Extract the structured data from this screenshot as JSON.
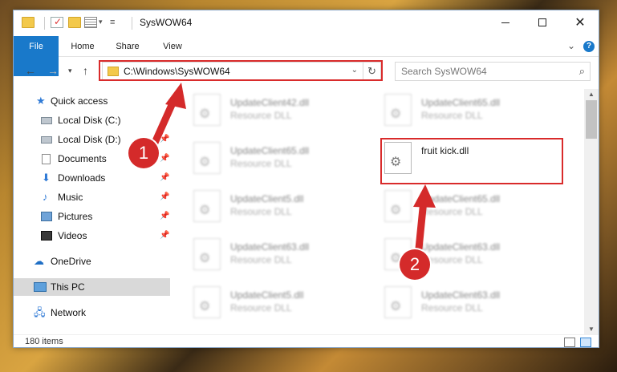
{
  "titlebar": {
    "title": "SysWOW64",
    "minimize_glyph": "",
    "close_glyph": "✕"
  },
  "ribbon": {
    "tabs": [
      "File",
      "Home",
      "Share",
      "View"
    ],
    "expand_glyph": "⌄",
    "help_glyph": "?"
  },
  "address": {
    "path": "C:\\Windows\\SysWOW64",
    "refresh_glyph": "↻"
  },
  "search": {
    "placeholder": "Search SysWOW64",
    "icon_glyph": "⌕"
  },
  "nav": {
    "items": [
      {
        "label": "Quick access",
        "icon": "star-icon"
      },
      {
        "label": "Local Disk (C:)",
        "icon": "drive-icon"
      },
      {
        "label": "Local Disk (D:)",
        "icon": "drive-icon"
      },
      {
        "label": "Documents",
        "icon": "documents-icon"
      },
      {
        "label": "Downloads",
        "icon": "download-icon"
      },
      {
        "label": "Music",
        "icon": "music-icon"
      },
      {
        "label": "Pictures",
        "icon": "pictures-icon"
      },
      {
        "label": "Videos",
        "icon": "videos-icon"
      },
      {
        "label": "OneDrive",
        "icon": "cloud-icon"
      },
      {
        "label": "This PC",
        "icon": "computer-icon"
      },
      {
        "label": "Network",
        "icon": "network-icon"
      }
    ]
  },
  "files": [
    {
      "name": "UpdateClient42.dll",
      "type": "Resource DLL"
    },
    {
      "name": "UpdateClient65.dll",
      "type": "Resource DLL"
    },
    {
      "name": "UpdateClient65.dll",
      "type": "Resource DLL"
    },
    {
      "name": "fruit kick.dll",
      "type": ""
    },
    {
      "name": "UpdateClient5.dll",
      "type": "Resource DLL"
    },
    {
      "name": "UpdateClient65.dll",
      "type": "Resource DLL"
    },
    {
      "name": "UpdateClient63.dll",
      "type": "Resource DLL"
    },
    {
      "name": "UpdateClient63.dll",
      "type": "Resource DLL"
    },
    {
      "name": "UpdateClient5.dll",
      "type": "Resource DLL"
    },
    {
      "name": "UpdateClient63.dll",
      "type": "Resource DLL"
    }
  ],
  "status": {
    "item_count": "180 items"
  },
  "annotations": {
    "step1": "1",
    "step2": "2",
    "color": "#d42a2a"
  }
}
